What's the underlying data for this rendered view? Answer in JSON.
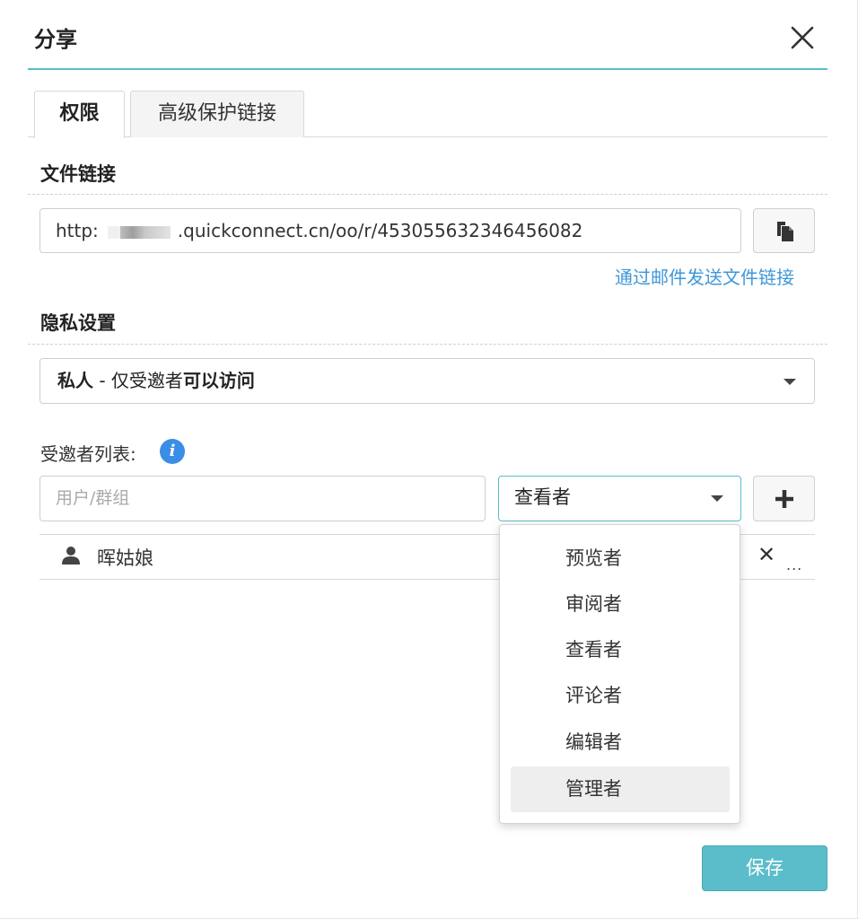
{
  "dialog": {
    "title": "分享",
    "close_icon": "close-icon",
    "accent_color": "#5bbdca",
    "link_color": "#3e97d8"
  },
  "tabs": [
    {
      "label": "权限",
      "active": true
    },
    {
      "label": "高级保护链接",
      "active": false
    }
  ],
  "file_link": {
    "section_title": "文件链接",
    "url_prefix": "http:",
    "url_suffix": ".quickconnect.cn/oo/r/453055632346456082",
    "copy_icon": "copy-icon",
    "email_link_label": "通过邮件发送文件链接"
  },
  "privacy": {
    "section_title": "隐私设置",
    "selected_prefix": "私人",
    "selected_middle": " - 仅受邀者",
    "selected_suffix": "可以访问"
  },
  "invitees": {
    "label": "受邀者列表:",
    "info_icon": "info-icon",
    "input_placeholder": "用户/群组",
    "role_selected": "查看者",
    "add_icon": "plus-icon",
    "list": [
      {
        "name": "晖姑娘",
        "icon": "person-icon",
        "remove_icon": "close-icon",
        "more": "..."
      }
    ]
  },
  "role_dropdown": {
    "options": [
      "预览者",
      "审阅者",
      "查看者",
      "评论者",
      "编辑者",
      "管理者"
    ],
    "hovered": "管理者"
  },
  "footer": {
    "save_label": "保存"
  }
}
